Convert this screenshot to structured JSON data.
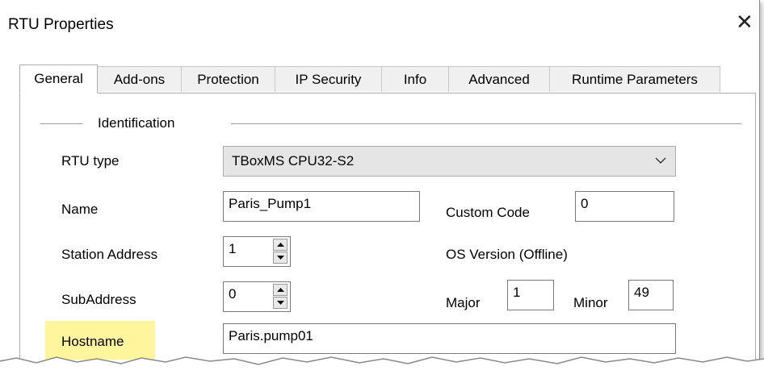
{
  "window": {
    "title": "RTU Properties",
    "close_glyph": "✕"
  },
  "tabs": [
    {
      "label": "General",
      "active": true
    },
    {
      "label": "Add-ons"
    },
    {
      "label": "Protection"
    },
    {
      "label": "IP Security"
    },
    {
      "label": "Info"
    },
    {
      "label": "Advanced"
    },
    {
      "label": "Runtime Parameters"
    }
  ],
  "identification": {
    "group_title": "Identification",
    "rtu_type": {
      "label": "RTU type",
      "value": "TBoxMS CPU32-S2",
      "icon": "chevron-down-icon"
    },
    "name": {
      "label": "Name",
      "value": "Paris_Pump1"
    },
    "custom_code": {
      "label": "Custom Code",
      "value": "0"
    },
    "station_address": {
      "label": "Station Address",
      "value": "1"
    },
    "os_version": {
      "label": "OS Version (Offline)"
    },
    "sub_address": {
      "label": "SubAddress",
      "value": "0"
    },
    "major": {
      "label": "Major",
      "value": "1"
    },
    "minor": {
      "label": "Minor",
      "value": "49"
    },
    "hostname": {
      "label": "Hostname",
      "value": "Paris.pump01",
      "highlight_color": "#fff59d"
    }
  }
}
